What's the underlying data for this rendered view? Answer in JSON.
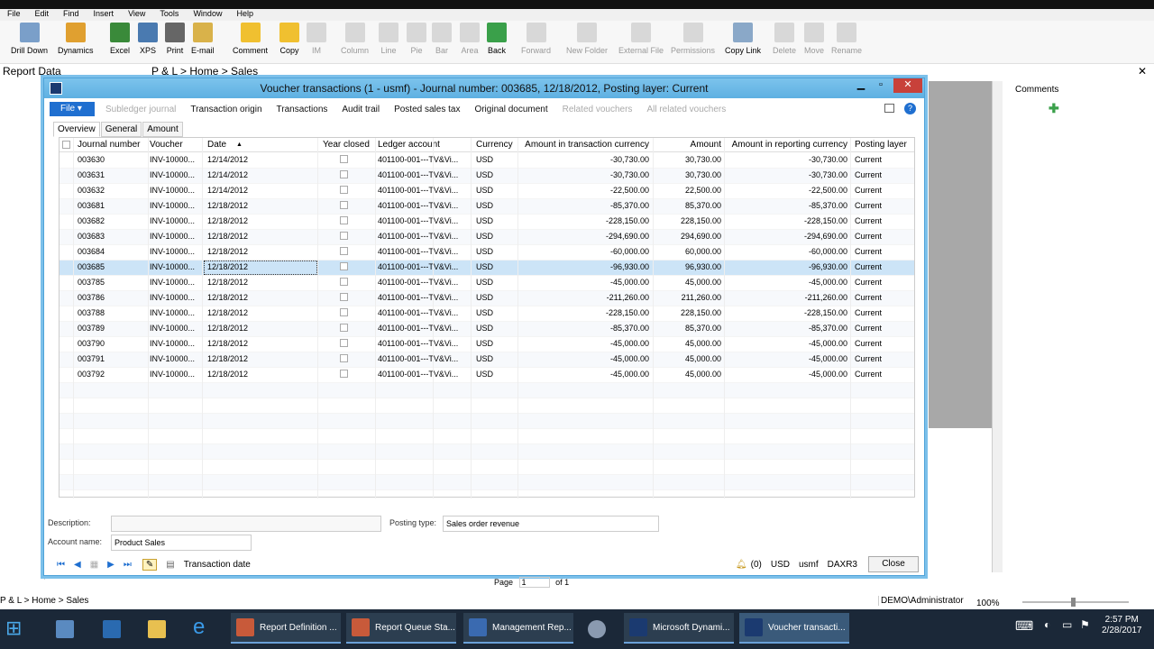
{
  "menu": [
    "File",
    "Edit",
    "Find",
    "Insert",
    "View",
    "Tools",
    "Window",
    "Help"
  ],
  "ribbon": [
    {
      "label": "Drill Down",
      "color": "#7a9fc9",
      "enabled": true
    },
    {
      "label": "Dynamics",
      "color": "#e0a030",
      "enabled": true
    },
    {
      "label": "Excel",
      "color": "#3a8a3a",
      "enabled": true
    },
    {
      "label": "XPS",
      "color": "#4a7ab0",
      "enabled": true
    },
    {
      "label": "Print",
      "color": "#666",
      "enabled": true
    },
    {
      "label": "E-mail",
      "color": "#d9b24a",
      "enabled": true
    },
    {
      "label": "Comment",
      "color": "#f0c030",
      "enabled": true
    },
    {
      "label": "Copy",
      "color": "#f0c030",
      "enabled": true
    },
    {
      "label": "IM",
      "color": "#ccc",
      "enabled": false
    },
    {
      "label": "Column",
      "color": "#ccc",
      "enabled": false
    },
    {
      "label": "Line",
      "color": "#ccc",
      "enabled": false
    },
    {
      "label": "Pie",
      "color": "#ccc",
      "enabled": false
    },
    {
      "label": "Bar",
      "color": "#ccc",
      "enabled": false
    },
    {
      "label": "Area",
      "color": "#ccc",
      "enabled": false
    },
    {
      "label": "Back",
      "color": "#3aa04a",
      "enabled": true
    },
    {
      "label": "Forward",
      "color": "#ccc",
      "enabled": false
    },
    {
      "label": "New Folder",
      "color": "#ccc",
      "enabled": false
    },
    {
      "label": "External File",
      "color": "#ccc",
      "enabled": false
    },
    {
      "label": "Permissions",
      "color": "#ccc",
      "enabled": false
    },
    {
      "label": "Copy Link",
      "color": "#8aa8c8",
      "enabled": true
    },
    {
      "label": "Delete",
      "color": "#ccc",
      "enabled": false
    },
    {
      "label": "Move",
      "color": "#ccc",
      "enabled": false
    },
    {
      "label": "Rename",
      "color": "#ccc",
      "enabled": false
    }
  ],
  "report_data_label": "Report Data",
  "breadcrumb_top": "P & L > Home > Sales",
  "comments_label": "Comments",
  "window": {
    "title": "Voucher transactions (1 - usmf) - Journal number: 003685, 12/18/2012, Posting layer: Current",
    "toolbar": [
      {
        "label": "Subledger journal",
        "enabled": false
      },
      {
        "label": "Transaction origin",
        "enabled": true
      },
      {
        "label": "Transactions",
        "enabled": true
      },
      {
        "label": "Audit trail",
        "enabled": true
      },
      {
        "label": "Posted sales tax",
        "enabled": true
      },
      {
        "label": "Original document",
        "enabled": true
      },
      {
        "label": "Related vouchers",
        "enabled": false
      },
      {
        "label": "All related vouchers",
        "enabled": false
      }
    ],
    "file_label": "File",
    "tabs": [
      "Overview",
      "General",
      "Amount"
    ],
    "columns": [
      "Journal number",
      "Voucher",
      "Date",
      "Year closed",
      "Ledger account",
      "Currency",
      "Amount in transaction currency",
      "Amount",
      "Amount in reporting currency",
      "Posting layer"
    ],
    "rows": [
      [
        "003630",
        "INV-10000...",
        "12/14/2012",
        "",
        "401100-001---TV&Vi...",
        "USD",
        "-30,730.00",
        "30,730.00",
        "-30,730.00",
        "Current"
      ],
      [
        "003631",
        "INV-10000...",
        "12/14/2012",
        "",
        "401100-001---TV&Vi...",
        "USD",
        "-30,730.00",
        "30,730.00",
        "-30,730.00",
        "Current"
      ],
      [
        "003632",
        "INV-10000...",
        "12/14/2012",
        "",
        "401100-001---TV&Vi...",
        "USD",
        "-22,500.00",
        "22,500.00",
        "-22,500.00",
        "Current"
      ],
      [
        "003681",
        "INV-10000...",
        "12/18/2012",
        "",
        "401100-001---TV&Vi...",
        "USD",
        "-85,370.00",
        "85,370.00",
        "-85,370.00",
        "Current"
      ],
      [
        "003682",
        "INV-10000...",
        "12/18/2012",
        "",
        "401100-001---TV&Vi...",
        "USD",
        "-228,150.00",
        "228,150.00",
        "-228,150.00",
        "Current"
      ],
      [
        "003683",
        "INV-10000...",
        "12/18/2012",
        "",
        "401100-001---TV&Vi...",
        "USD",
        "-294,690.00",
        "294,690.00",
        "-294,690.00",
        "Current"
      ],
      [
        "003684",
        "INV-10000...",
        "12/18/2012",
        "",
        "401100-001---TV&Vi...",
        "USD",
        "-60,000.00",
        "60,000.00",
        "-60,000.00",
        "Current"
      ],
      [
        "003685",
        "INV-10000...",
        "12/18/2012",
        "",
        "401100-001---TV&Vi...",
        "USD",
        "-96,930.00",
        "96,930.00",
        "-96,930.00",
        "Current"
      ],
      [
        "003785",
        "INV-10000...",
        "12/18/2012",
        "",
        "401100-001---TV&Vi...",
        "USD",
        "-45,000.00",
        "45,000.00",
        "-45,000.00",
        "Current"
      ],
      [
        "003786",
        "INV-10000...",
        "12/18/2012",
        "",
        "401100-001---TV&Vi...",
        "USD",
        "-211,260.00",
        "211,260.00",
        "-211,260.00",
        "Current"
      ],
      [
        "003788",
        "INV-10000...",
        "12/18/2012",
        "",
        "401100-001---TV&Vi...",
        "USD",
        "-228,150.00",
        "228,150.00",
        "-228,150.00",
        "Current"
      ],
      [
        "003789",
        "INV-10000...",
        "12/18/2012",
        "",
        "401100-001---TV&Vi...",
        "USD",
        "-85,370.00",
        "85,370.00",
        "-85,370.00",
        "Current"
      ],
      [
        "003790",
        "INV-10000...",
        "12/18/2012",
        "",
        "401100-001---TV&Vi...",
        "USD",
        "-45,000.00",
        "45,000.00",
        "-45,000.00",
        "Current"
      ],
      [
        "003791",
        "INV-10000...",
        "12/18/2012",
        "",
        "401100-001---TV&Vi...",
        "USD",
        "-45,000.00",
        "45,000.00",
        "-45,000.00",
        "Current"
      ],
      [
        "003792",
        "INV-10000...",
        "12/18/2012",
        "",
        "401100-001---TV&Vi...",
        "USD",
        "-45,000.00",
        "45,000.00",
        "-45,000.00",
        "Current"
      ]
    ],
    "selected_row": 7,
    "description_label": "Description:",
    "description_value": "",
    "account_name_label": "Account name:",
    "account_name_value": "Product Sales",
    "posting_type_label": "Posting type:",
    "posting_type_value": "Sales order revenue",
    "status_field": "Transaction date",
    "status_alerts": "(0)",
    "status_currency": "USD",
    "status_company": "usmf",
    "status_server": "DAXR3",
    "close_label": "Close"
  },
  "page_label": "Page",
  "page_value": "1",
  "page_of": "of 1",
  "breadcrumb_bottom": "P & L > Home > Sales",
  "user": "DEMO\\Administrator",
  "zoom": "100%",
  "taskbar": [
    {
      "label": "Report Definition ...",
      "color": "#c85a3a"
    },
    {
      "label": "Report Queue Sta...",
      "color": "#c85a3a"
    },
    {
      "label": "Management Rep...",
      "color": "#3a6ab0"
    },
    {
      "label": "Microsoft Dynami...",
      "color": "#1b3a70"
    },
    {
      "label": "Voucher transacti...",
      "color": "#1b3a70"
    }
  ],
  "clock_time": "2:57 PM",
  "clock_date": "2/28/2017"
}
